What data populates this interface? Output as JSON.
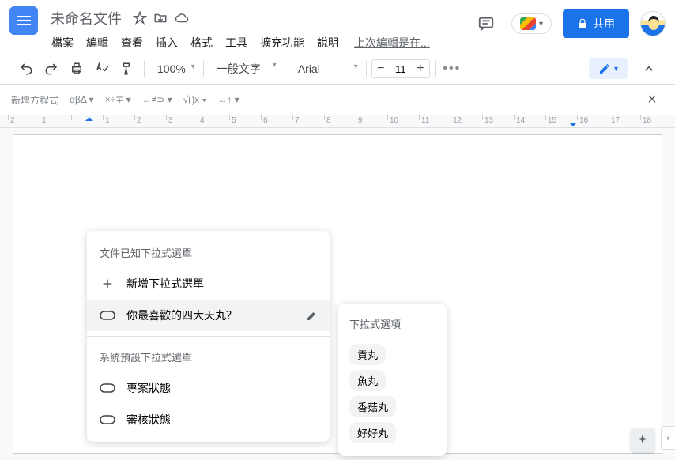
{
  "doc": {
    "title": "未命名文件",
    "lastEdit": "上次編輯是在..."
  },
  "menu": [
    "檔案",
    "編輯",
    "查看",
    "插入",
    "格式",
    "工具",
    "擴充功能",
    "說明"
  ],
  "share": "共用",
  "toolbar": {
    "zoom": "100%",
    "style": "一般文字",
    "font": "Arial",
    "fontSize": "11"
  },
  "equation": {
    "new": "新增方程式",
    "greek": "αβΔ",
    "ops": "×÷∓",
    "rel": "←≠⊃",
    "root": "√⟮⟯x",
    "arrow": "↔↑"
  },
  "ruler": [
    "2",
    "1",
    "",
    "1",
    "2",
    "3",
    "4",
    "5",
    "6",
    "7",
    "8",
    "9",
    "10",
    "11",
    "12",
    "13",
    "14",
    "15",
    "16",
    "17",
    "18"
  ],
  "dropdown": {
    "section1": "文件已知下拉式選單",
    "add": "新增下拉式選單",
    "custom": "你最喜歡的四大天丸？",
    "section2": "系統預設下拉式選單",
    "preset1": "專案狀態",
    "preset2": "審核狀態"
  },
  "options": {
    "header": "下拉式選項",
    "items": [
      "貢丸",
      "魚丸",
      "香菇丸",
      "好好丸"
    ]
  }
}
